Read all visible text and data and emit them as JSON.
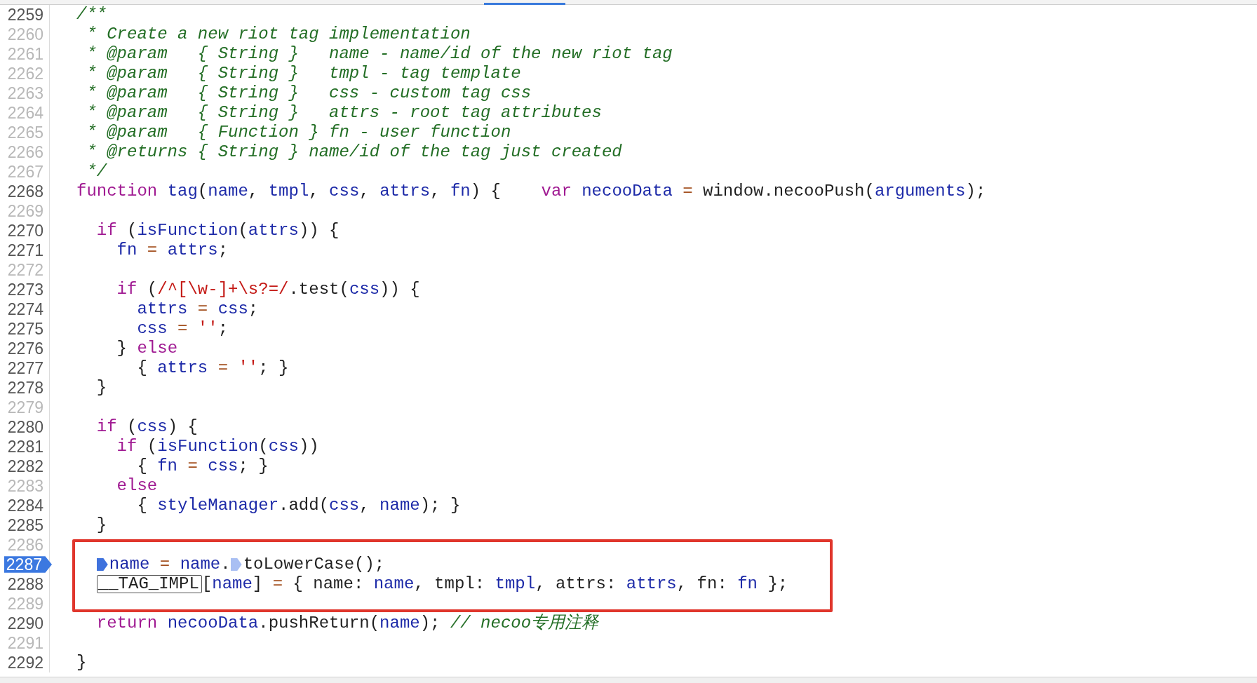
{
  "lines": [
    {
      "number": "2259",
      "dimmed": false,
      "breakpoint": false,
      "highlighted": false,
      "tokens": [
        {
          "kind": "comment",
          "text": "/**"
        }
      ]
    },
    {
      "number": "2260",
      "dimmed": true,
      "breakpoint": false,
      "highlighted": false,
      "tokens": [
        {
          "kind": "comment",
          "text": " * Create a new riot tag implementation"
        }
      ]
    },
    {
      "number": "2261",
      "dimmed": true,
      "breakpoint": false,
      "highlighted": false,
      "tokens": [
        {
          "kind": "comment",
          "text": " * @param   { String }   name - name/id of the new riot tag"
        }
      ]
    },
    {
      "number": "2262",
      "dimmed": true,
      "breakpoint": false,
      "highlighted": false,
      "tokens": [
        {
          "kind": "comment",
          "text": " * @param   { String }   tmpl - tag template"
        }
      ]
    },
    {
      "number": "2263",
      "dimmed": true,
      "breakpoint": false,
      "highlighted": false,
      "tokens": [
        {
          "kind": "comment",
          "text": " * @param   { String }   css - custom tag css"
        }
      ]
    },
    {
      "number": "2264",
      "dimmed": true,
      "breakpoint": false,
      "highlighted": false,
      "tokens": [
        {
          "kind": "comment",
          "text": " * @param   { String }   attrs - root tag attributes"
        }
      ]
    },
    {
      "number": "2265",
      "dimmed": true,
      "breakpoint": false,
      "highlighted": false,
      "tokens": [
        {
          "kind": "comment",
          "text": " * @param   { Function } fn - user function"
        }
      ]
    },
    {
      "number": "2266",
      "dimmed": true,
      "breakpoint": false,
      "highlighted": false,
      "tokens": [
        {
          "kind": "comment",
          "text": " * @returns { String } name/id of the tag just created"
        }
      ]
    },
    {
      "number": "2267",
      "dimmed": true,
      "breakpoint": false,
      "highlighted": false,
      "tokens": [
        {
          "kind": "comment",
          "text": " */"
        }
      ]
    },
    {
      "number": "2268",
      "dimmed": false,
      "breakpoint": false,
      "highlighted": false,
      "tokens": [
        {
          "kind": "keyword",
          "text": "function "
        },
        {
          "kind": "variable",
          "text": "tag"
        },
        {
          "kind": "plain",
          "text": "("
        },
        {
          "kind": "variable",
          "text": "name"
        },
        {
          "kind": "plain",
          "text": ", "
        },
        {
          "kind": "variable",
          "text": "tmpl"
        },
        {
          "kind": "plain",
          "text": ", "
        },
        {
          "kind": "variable",
          "text": "css"
        },
        {
          "kind": "plain",
          "text": ", "
        },
        {
          "kind": "variable",
          "text": "attrs"
        },
        {
          "kind": "plain",
          "text": ", "
        },
        {
          "kind": "variable",
          "text": "fn"
        },
        {
          "kind": "plain",
          "text": ") {    "
        },
        {
          "kind": "keyword",
          "text": "var "
        },
        {
          "kind": "variable",
          "text": "necooData "
        },
        {
          "kind": "operator",
          "text": "= "
        },
        {
          "kind": "plain",
          "text": "window.necooPush("
        },
        {
          "kind": "variable",
          "text": "arguments"
        },
        {
          "kind": "plain",
          "text": ");"
        }
      ]
    },
    {
      "number": "2269",
      "dimmed": true,
      "breakpoint": false,
      "highlighted": false
    },
    {
      "number": "2270",
      "dimmed": false,
      "breakpoint": false,
      "highlighted": false,
      "tokens": [
        {
          "kind": "keyword",
          "text": "  if"
        },
        {
          "kind": "plain",
          "text": " ("
        },
        {
          "kind": "variable",
          "text": "isFunction"
        },
        {
          "kind": "plain",
          "text": "("
        },
        {
          "kind": "variable",
          "text": "attrs"
        },
        {
          "kind": "plain",
          "text": ")) {"
        }
      ]
    },
    {
      "number": "2271",
      "dimmed": false,
      "breakpoint": false,
      "highlighted": false,
      "tokens": [
        {
          "kind": "variable",
          "text": "    fn "
        },
        {
          "kind": "operator",
          "text": "= "
        },
        {
          "kind": "variable",
          "text": "attrs"
        },
        {
          "kind": "plain",
          "text": ";"
        }
      ]
    },
    {
      "number": "2272",
      "dimmed": true,
      "breakpoint": false,
      "highlighted": false
    },
    {
      "number": "2273",
      "dimmed": false,
      "breakpoint": false,
      "highlighted": false,
      "tokens": [
        {
          "kind": "keyword",
          "text": "    if"
        },
        {
          "kind": "plain",
          "text": " ("
        },
        {
          "kind": "regex",
          "text": "/^[\\w-]+\\s?=/"
        },
        {
          "kind": "plain",
          "text": ".test("
        },
        {
          "kind": "variable",
          "text": "css"
        },
        {
          "kind": "plain",
          "text": ")) {"
        }
      ]
    },
    {
      "number": "2274",
      "dimmed": false,
      "breakpoint": false,
      "highlighted": false,
      "tokens": [
        {
          "kind": "variable",
          "text": "      attrs "
        },
        {
          "kind": "operator",
          "text": "= "
        },
        {
          "kind": "variable",
          "text": "css"
        },
        {
          "kind": "plain",
          "text": ";"
        }
      ]
    },
    {
      "number": "2275",
      "dimmed": false,
      "breakpoint": false,
      "highlighted": false,
      "tokens": [
        {
          "kind": "variable",
          "text": "      css "
        },
        {
          "kind": "operator",
          "text": "= "
        },
        {
          "kind": "string",
          "text": "''"
        },
        {
          "kind": "plain",
          "text": ";"
        }
      ]
    },
    {
      "number": "2276",
      "dimmed": false,
      "breakpoint": false,
      "highlighted": false,
      "tokens": [
        {
          "kind": "plain",
          "text": "    } "
        },
        {
          "kind": "keyword",
          "text": "else"
        }
      ]
    },
    {
      "number": "2277",
      "dimmed": false,
      "breakpoint": false,
      "highlighted": false,
      "tokens": [
        {
          "kind": "plain",
          "text": "      { "
        },
        {
          "kind": "variable",
          "text": "attrs "
        },
        {
          "kind": "operator",
          "text": "= "
        },
        {
          "kind": "string",
          "text": "''"
        },
        {
          "kind": "plain",
          "text": "; }"
        }
      ]
    },
    {
      "number": "2278",
      "dimmed": false,
      "breakpoint": false,
      "highlighted": false,
      "tokens": [
        {
          "kind": "plain",
          "text": "  }"
        }
      ]
    },
    {
      "number": "2279",
      "dimmed": true,
      "breakpoint": false,
      "highlighted": false
    },
    {
      "number": "2280",
      "dimmed": false,
      "breakpoint": false,
      "highlighted": false,
      "tokens": [
        {
          "kind": "keyword",
          "text": "  if"
        },
        {
          "kind": "plain",
          "text": " ("
        },
        {
          "kind": "variable",
          "text": "css"
        },
        {
          "kind": "plain",
          "text": ") {"
        }
      ]
    },
    {
      "number": "2281",
      "dimmed": false,
      "breakpoint": false,
      "highlighted": false,
      "tokens": [
        {
          "kind": "keyword",
          "text": "    if"
        },
        {
          "kind": "plain",
          "text": " ("
        },
        {
          "kind": "variable",
          "text": "isFunction"
        },
        {
          "kind": "plain",
          "text": "("
        },
        {
          "kind": "variable",
          "text": "css"
        },
        {
          "kind": "plain",
          "text": "))"
        }
      ]
    },
    {
      "number": "2282",
      "dimmed": false,
      "breakpoint": false,
      "highlighted": false,
      "tokens": [
        {
          "kind": "plain",
          "text": "      { "
        },
        {
          "kind": "variable",
          "text": "fn "
        },
        {
          "kind": "operator",
          "text": "= "
        },
        {
          "kind": "variable",
          "text": "css"
        },
        {
          "kind": "plain",
          "text": "; }"
        }
      ]
    },
    {
      "number": "2283",
      "dimmed": true,
      "breakpoint": false,
      "highlighted": false,
      "tokens": [
        {
          "kind": "keyword",
          "text": "    else"
        }
      ]
    },
    {
      "number": "2284",
      "dimmed": false,
      "breakpoint": false,
      "highlighted": false,
      "tokens": [
        {
          "kind": "plain",
          "text": "      { "
        },
        {
          "kind": "variable",
          "text": "styleManager"
        },
        {
          "kind": "plain",
          "text": ".add("
        },
        {
          "kind": "variable",
          "text": "css"
        },
        {
          "kind": "plain",
          "text": ", "
        },
        {
          "kind": "variable",
          "text": "name"
        },
        {
          "kind": "plain",
          "text": "); }"
        }
      ]
    },
    {
      "number": "2285",
      "dimmed": false,
      "breakpoint": false,
      "highlighted": false,
      "tokens": [
        {
          "kind": "plain",
          "text": "  }"
        }
      ]
    },
    {
      "number": "2286",
      "dimmed": true,
      "breakpoint": false,
      "highlighted": false
    },
    {
      "number": "2287",
      "dimmed": false,
      "breakpoint": true,
      "highlighted": true,
      "tokens": [
        {
          "kind": "marker",
          "active": true
        },
        {
          "kind": "variable",
          "text": "name "
        },
        {
          "kind": "operator",
          "text": "= "
        },
        {
          "kind": "variable",
          "text": "name"
        },
        {
          "kind": "plain",
          "text": "."
        },
        {
          "kind": "marker",
          "active": false
        },
        {
          "kind": "plain",
          "text": "toLowerCase();"
        }
      ]
    },
    {
      "number": "2288",
      "dimmed": false,
      "breakpoint": false,
      "highlighted": true,
      "tokens": [
        {
          "kind": "outlined",
          "text": "__TAG_IMPL"
        },
        {
          "kind": "plain",
          "text": "["
        },
        {
          "kind": "variable",
          "text": "name"
        },
        {
          "kind": "plain",
          "text": "] "
        },
        {
          "kind": "operator",
          "text": "= "
        },
        {
          "kind": "plain",
          "text": "{ name: "
        },
        {
          "kind": "variable",
          "text": "name"
        },
        {
          "kind": "plain",
          "text": ", tmpl: "
        },
        {
          "kind": "variable",
          "text": "tmpl"
        },
        {
          "kind": "plain",
          "text": ", attrs: "
        },
        {
          "kind": "variable",
          "text": "attrs"
        },
        {
          "kind": "plain",
          "text": ", fn: "
        },
        {
          "kind": "variable",
          "text": "fn"
        },
        {
          "kind": "plain",
          "text": " };"
        }
      ]
    },
    {
      "number": "2289",
      "dimmed": true,
      "breakpoint": false,
      "highlighted": true
    },
    {
      "number": "2290",
      "dimmed": false,
      "breakpoint": false,
      "highlighted": false,
      "tokens": [
        {
          "kind": "keyword",
          "text": "  return "
        },
        {
          "kind": "variable",
          "text": "necooData"
        },
        {
          "kind": "plain",
          "text": ".pushReturn("
        },
        {
          "kind": "variable",
          "text": "name"
        },
        {
          "kind": "plain",
          "text": "); "
        },
        {
          "kind": "comment",
          "text": "// necoo专用注释"
        }
      ]
    },
    {
      "number": "2291",
      "dimmed": true,
      "breakpoint": false,
      "highlighted": false
    },
    {
      "number": "2292",
      "dimmed": false,
      "breakpoint": false,
      "highlighted": false,
      "tokens": [
        {
          "kind": "plain",
          "text": "}"
        }
      ]
    }
  ]
}
